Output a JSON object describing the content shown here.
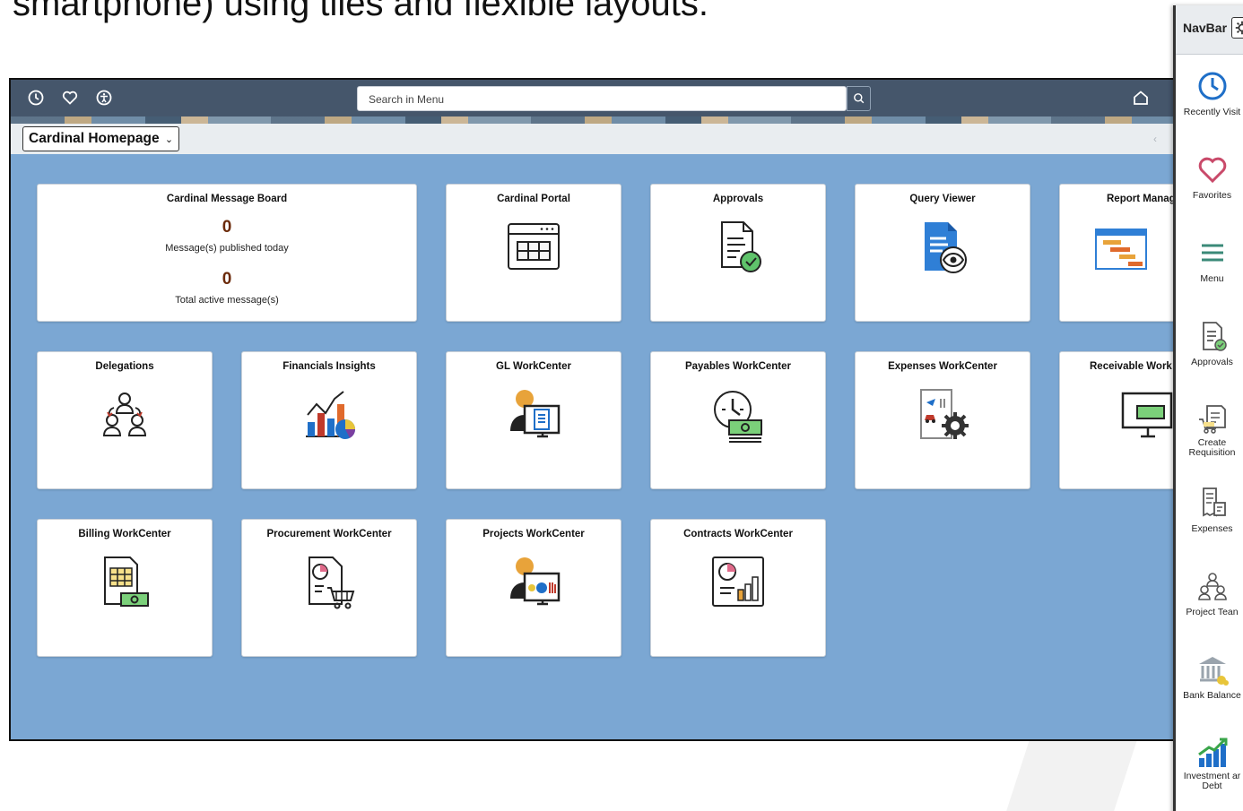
{
  "slide": {
    "heading": "smartphone) using tiles and flexible layouts."
  },
  "topbar": {
    "search_placeholder": "Search in Menu",
    "icons": [
      "recent-icon",
      "favorites-icon",
      "accessibility-icon",
      "search-icon",
      "home-icon"
    ]
  },
  "pagebar": {
    "homepage_label": "Cardinal Homepage",
    "dropdown_caret": "⌄",
    "prev_arrow": "‹"
  },
  "tiles": [
    {
      "title": "Cardinal Message Board",
      "icon": "message-board"
    },
    {
      "title": "Cardinal Portal",
      "icon": "portal-window-icon"
    },
    {
      "title": "Approvals",
      "icon": "approval-document-icon"
    },
    {
      "title": "Query Viewer",
      "icon": "query-viewer-icon"
    },
    {
      "title": "Report Manag",
      "icon": "report-manager-icon"
    },
    {
      "title": "Delegations",
      "icon": "delegations-icon"
    },
    {
      "title": "Financials Insights",
      "icon": "financial-insights-icon"
    },
    {
      "title": "GL WorkCenter",
      "icon": "gl-workcenter-icon"
    },
    {
      "title": "Payables WorkCenter",
      "icon": "payables-workcenter-icon"
    },
    {
      "title": "Expenses WorkCenter",
      "icon": "expenses-workcenter-icon"
    },
    {
      "title": "Receivable Work",
      "icon": "receivable-workcenter-icon"
    },
    {
      "title": "Billing WorkCenter",
      "icon": "billing-workcenter-icon"
    },
    {
      "title": "Procurement WorkCenter",
      "icon": "procurement-workcenter-icon"
    },
    {
      "title": "Projects WorkCenter",
      "icon": "projects-workcenter-icon"
    },
    {
      "title": "Contracts WorkCenter",
      "icon": "contracts-workcenter-icon"
    }
  ],
  "message_board": {
    "published_count": "0",
    "published_label": "Message(s) published today",
    "active_count": "0",
    "active_label": "Total active message(s)"
  },
  "navbar": {
    "title": "NavBar",
    "items": [
      {
        "label": "Recently Visit",
        "icon": "clock-icon"
      },
      {
        "label": "Favorites",
        "icon": "heart-icon"
      },
      {
        "label": "Menu",
        "icon": "menu-icon"
      },
      {
        "label": "Approvals",
        "icon": "approvals-icon"
      },
      {
        "label": "Create\nRequisition",
        "icon": "requisition-cart-icon"
      },
      {
        "label": "Expenses",
        "icon": "expenses-receipt-icon"
      },
      {
        "label": "Project Tean",
        "icon": "project-team-icon"
      },
      {
        "label": "Bank Balance",
        "icon": "bank-icon"
      },
      {
        "label": "Investment ar\nDebt",
        "icon": "investment-chart-icon"
      }
    ]
  },
  "colors": {
    "topbar": "#45566b",
    "canvas": "#7ba7d3",
    "count": "#6b2a0a",
    "accent_green": "#3aa54a",
    "accent_blue": "#1f6fc8",
    "accent_orange": "#e8a33a"
  }
}
